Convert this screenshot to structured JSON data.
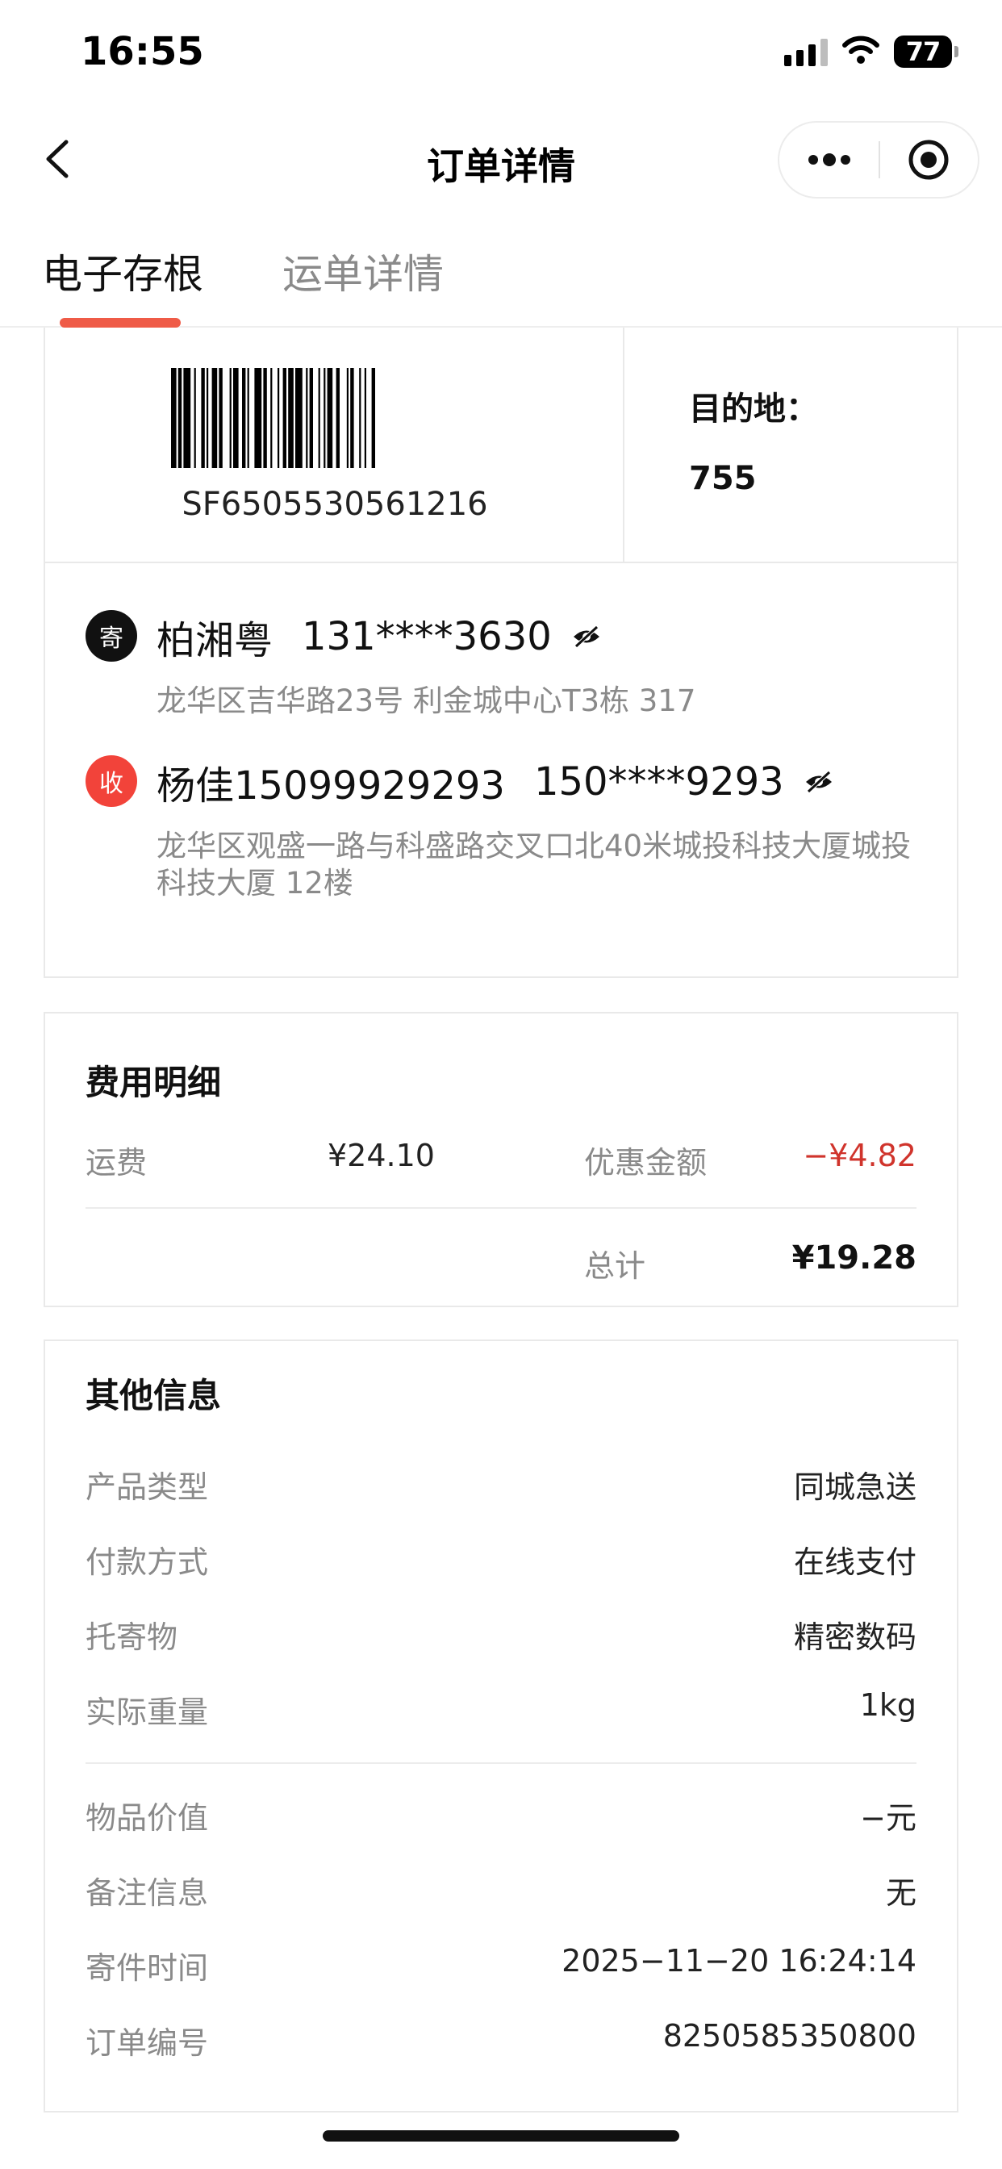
{
  "status_bar": {
    "time": "16:55",
    "battery": "77"
  },
  "nav": {
    "title": "订单详情"
  },
  "tabs": [
    {
      "label": "电子存根",
      "active": true
    },
    {
      "label": "运单详情",
      "active": false
    }
  ],
  "shipment": {
    "waybill_no": "SF6505530561216",
    "destination_label": "目的地：",
    "destination_code": "755"
  },
  "sender": {
    "badge": "寄",
    "name": "柏湘粤",
    "phone": "131****3630",
    "address": "龙华区吉华路23号 利金城中心T3栋 317"
  },
  "receiver": {
    "badge": "收",
    "name": "杨佳15099929293",
    "phone": "150****9293",
    "address": "龙华区观盛一路与科盛路交叉口北40米城投科技大厦城投科技大厦 12楼"
  },
  "fee": {
    "title": "费用明细",
    "freight_label": "运费",
    "freight_value": "¥24.10",
    "discount_label": "优惠金额",
    "discount_value": "−¥4.82",
    "total_label": "总计",
    "total_value": "¥19.28"
  },
  "other": {
    "title": "其他信息",
    "rows": [
      {
        "key": "产品类型",
        "value": "同城急送"
      },
      {
        "key": "付款方式",
        "value": "在线支付"
      },
      {
        "key": "托寄物",
        "value": "精密数码"
      },
      {
        "key": "实际重量",
        "value": "1kg"
      },
      {
        "key": "物品价值",
        "value": "−元"
      },
      {
        "key": "备注信息",
        "value": "无"
      },
      {
        "key": "寄件时间",
        "value": "2025−11−20 16:24:14"
      },
      {
        "key": "订单编号",
        "value": "8250585350800"
      }
    ]
  },
  "colors": {
    "accent": "#ef5b47",
    "discount": "#d0342c",
    "receiver_badge": "#f2433a",
    "muted_text": "#8a8a8a"
  }
}
